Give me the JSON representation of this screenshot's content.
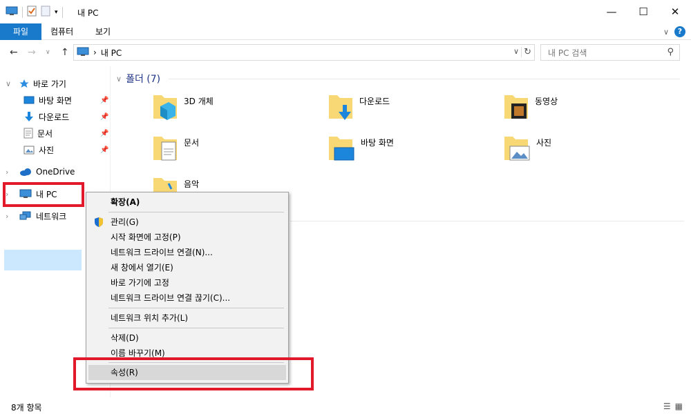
{
  "window": {
    "title": "내 PC",
    "minimize": "—",
    "maximize": "☐",
    "close": "✕"
  },
  "ribbon": {
    "tabs": [
      "파일",
      "컴퓨터",
      "보기"
    ],
    "expand": "∨",
    "help": "?"
  },
  "address": {
    "back": "←",
    "forward": "→",
    "up_history": "∨",
    "up": "↑",
    "crumb": "내 PC",
    "separator": "›",
    "dropdown": "∨",
    "refresh": "↻"
  },
  "search": {
    "placeholder": "내 PC 검색"
  },
  "nav": {
    "quick_access": "바로 가기",
    "quick_items": [
      "바탕 화면",
      "다운로드",
      "문서",
      "사진"
    ],
    "onedrive": "OneDrive",
    "this_pc": "내 PC",
    "network": "네트워크"
  },
  "content": {
    "group_title": "폴더 (7)",
    "folders": [
      "3D 개체",
      "다운로드",
      "동영상",
      "문서",
      "바탕 화면",
      "사진",
      "음악"
    ]
  },
  "context_menu": {
    "items": [
      "확장(A)",
      "관리(G)",
      "시작 화면에 고정(P)",
      "네트워크 드라이브 연결(N)...",
      "새 창에서 열기(E)",
      "바로 가기에 고정",
      "네트워크 드라이브 연결 끊기(C)...",
      "네트워크 위치 추가(L)",
      "삭제(D)",
      "이름 바꾸기(M)",
      "속성(R)"
    ]
  },
  "status": {
    "count": "8개 항목"
  },
  "colors": {
    "accent": "#1979ca",
    "highlight": "#e2192a",
    "selection": "#cce8ff",
    "folder": "#f8d775"
  }
}
